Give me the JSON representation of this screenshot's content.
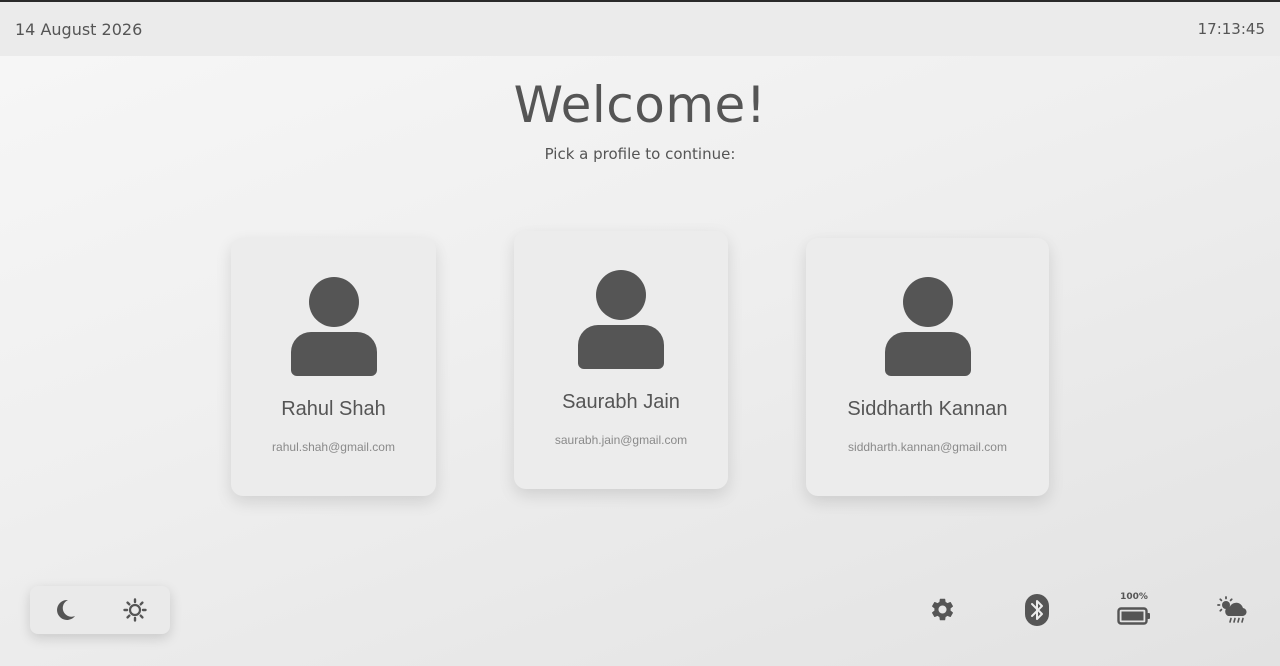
{
  "header": {
    "date": "14 August 2026",
    "time": "17:13:45"
  },
  "main": {
    "title": "Welcome!",
    "subtitle": "Pick a profile to continue:"
  },
  "profiles": [
    {
      "name": "Rahul Shah",
      "email": "rahul.shah@gmail.com",
      "icon": "user-icon"
    },
    {
      "name": "Saurabh Jain",
      "email": "saurabh.jain@gmail.com",
      "icon": "user-icon"
    },
    {
      "name": "Siddharth Kannan",
      "email": "siddharth.kannan@gmail.com",
      "icon": "user-icon"
    }
  ],
  "theme_toggle": {
    "items": [
      {
        "icon": "moon-icon",
        "mode": "dark"
      },
      {
        "icon": "sun-icon",
        "mode": "light"
      }
    ]
  },
  "status_bar": {
    "settings_icon": "gear-icon",
    "bluetooth_icon": "bluetooth-icon",
    "battery": {
      "icon": "battery-icon",
      "percent_label": "100%",
      "level": 1.0
    },
    "weather_icon": "weather-sun-rain-icon"
  },
  "colors": {
    "icon": "#555555",
    "card_background": "#ececec",
    "page_background": "#efefef"
  }
}
